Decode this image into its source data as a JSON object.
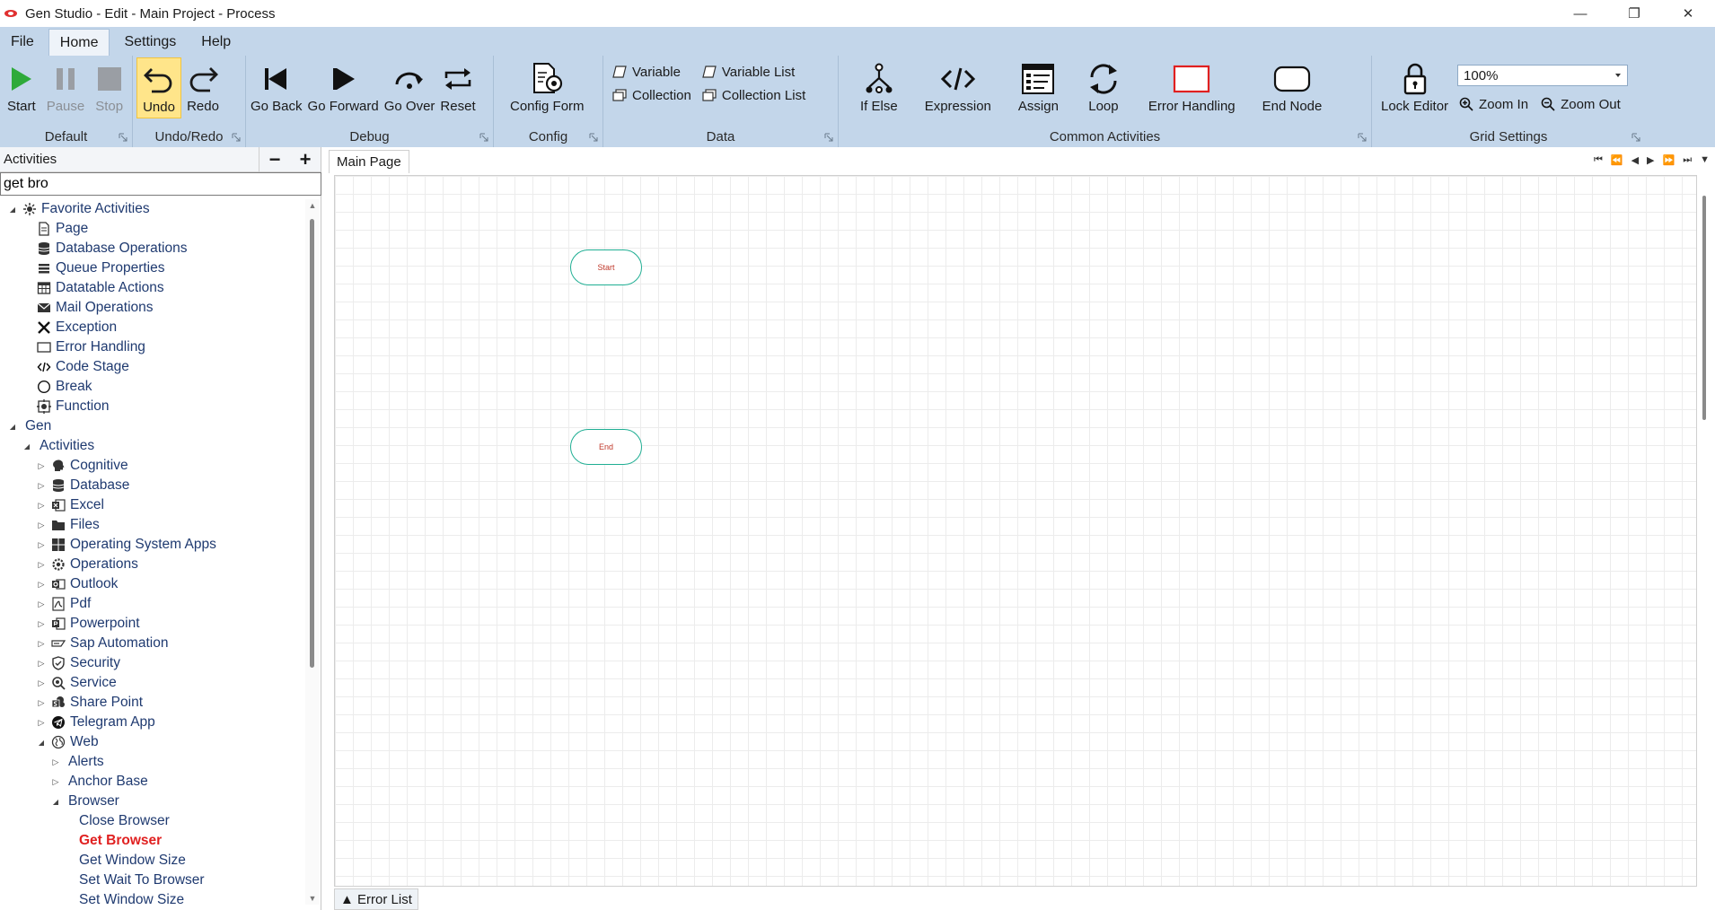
{
  "window": {
    "title": "Gen Studio - Edit - Main Project - Process",
    "controls": {
      "minimize": "—",
      "restore": "❐",
      "close": "✕"
    }
  },
  "menu": {
    "tabs": [
      {
        "label": "File"
      },
      {
        "label": "Home"
      },
      {
        "label": "Settings"
      },
      {
        "label": "Help"
      }
    ]
  },
  "ribbon": {
    "default": {
      "label": "Default",
      "start": "Start",
      "pause": "Pause",
      "stop": "Stop"
    },
    "undo_redo": {
      "label": "Undo/Redo",
      "undo": "Undo",
      "redo": "Redo"
    },
    "debug": {
      "label": "Debug",
      "go_back": "Go Back",
      "go_forward": "Go Forward",
      "go_over": "Go Over",
      "reset": "Reset"
    },
    "config": {
      "label": "Config",
      "config_form": "Config Form"
    },
    "data": {
      "label": "Data",
      "variable": "Variable",
      "collection": "Collection",
      "variable_list": "Variable List",
      "collection_list": "Collection List"
    },
    "common": {
      "label": "Common Activities",
      "if_else": "If Else",
      "expression": "Expression",
      "assign": "Assign",
      "loop": "Loop",
      "error_handling": "Error Handling",
      "end_node": "End Node"
    },
    "grid": {
      "label": "Grid Settings",
      "lock_editor": "Lock Editor",
      "zoom_value": "100%",
      "zoom_in": "Zoom In",
      "zoom_out": "Zoom Out"
    }
  },
  "activities_panel": {
    "title": "Activities",
    "search_value": "get bro",
    "tree": [
      {
        "label": "Favorite Activities",
        "level": 0,
        "expander": "expanded",
        "icon": "favorites-icon"
      },
      {
        "label": "Page",
        "level": 1,
        "expander": "none",
        "icon": "page-icon"
      },
      {
        "label": "Database Operations",
        "level": 1,
        "expander": "none",
        "icon": "database-icon"
      },
      {
        "label": "Queue Properties",
        "level": 1,
        "expander": "none",
        "icon": "queue-icon"
      },
      {
        "label": "Datatable Actions",
        "level": 1,
        "expander": "none",
        "icon": "datatable-icon"
      },
      {
        "label": "Mail Operations",
        "level": 1,
        "expander": "none",
        "icon": "mail-icon"
      },
      {
        "label": "Exception",
        "level": 1,
        "expander": "none",
        "icon": "exception-icon"
      },
      {
        "label": "Error Handling",
        "level": 1,
        "expander": "none",
        "icon": "error-handling-icon"
      },
      {
        "label": "Code Stage",
        "level": 1,
        "expander": "none",
        "icon": "code-icon"
      },
      {
        "label": "Break",
        "level": 1,
        "expander": "none",
        "icon": "break-icon"
      },
      {
        "label": "Function",
        "level": 1,
        "expander": "none",
        "icon": "function-icon"
      },
      {
        "label": "Gen",
        "level": 0,
        "expander": "expanded",
        "icon": ""
      },
      {
        "label": "Activities",
        "level": 1,
        "expander": "expanded",
        "icon": ""
      },
      {
        "label": "Cognitive",
        "level": 2,
        "expander": "collapsed",
        "icon": "cognitive-icon"
      },
      {
        "label": "Database",
        "level": 2,
        "expander": "collapsed",
        "icon": "database-icon"
      },
      {
        "label": "Excel",
        "level": 2,
        "expander": "collapsed",
        "icon": "excel-icon"
      },
      {
        "label": "Files",
        "level": 2,
        "expander": "collapsed",
        "icon": "folder-icon"
      },
      {
        "label": "Operating System Apps",
        "level": 2,
        "expander": "collapsed",
        "icon": "windows-icon"
      },
      {
        "label": "Operations",
        "level": 2,
        "expander": "collapsed",
        "icon": "gear-icon"
      },
      {
        "label": "Outlook",
        "level": 2,
        "expander": "collapsed",
        "icon": "outlook-icon"
      },
      {
        "label": "Pdf",
        "level": 2,
        "expander": "collapsed",
        "icon": "pdf-icon"
      },
      {
        "label": "Powerpoint",
        "level": 2,
        "expander": "collapsed",
        "icon": "powerpoint-icon"
      },
      {
        "label": "Sap Automation",
        "level": 2,
        "expander": "collapsed",
        "icon": "sap-icon"
      },
      {
        "label": "Security",
        "level": 2,
        "expander": "collapsed",
        "icon": "shield-icon"
      },
      {
        "label": "Service",
        "level": 2,
        "expander": "collapsed",
        "icon": "service-icon"
      },
      {
        "label": "Share Point",
        "level": 2,
        "expander": "collapsed",
        "icon": "sharepoint-icon"
      },
      {
        "label": "Telegram App",
        "level": 2,
        "expander": "collapsed",
        "icon": "telegram-icon"
      },
      {
        "label": "Web",
        "level": 2,
        "expander": "expanded",
        "icon": "web-icon"
      },
      {
        "label": "Alerts",
        "level": 3,
        "expander": "collapsed",
        "icon": ""
      },
      {
        "label": "Anchor Base",
        "level": 3,
        "expander": "collapsed",
        "icon": ""
      },
      {
        "label": "Browser",
        "level": 3,
        "expander": "expanded",
        "icon": ""
      },
      {
        "label": "Close Browser",
        "level": 4,
        "expander": "none",
        "icon": ""
      },
      {
        "label": "Get Browser",
        "level": 4,
        "expander": "none",
        "icon": "",
        "selected": true
      },
      {
        "label": "Get Window Size",
        "level": 4,
        "expander": "none",
        "icon": ""
      },
      {
        "label": "Set Wait To Browser",
        "level": 4,
        "expander": "none",
        "icon": ""
      },
      {
        "label": "Set Window Size",
        "level": 4,
        "expander": "none",
        "icon": ""
      }
    ]
  },
  "editor": {
    "tab": "Main Page",
    "nodes": {
      "start": "Start",
      "end": "End"
    },
    "error_list": "▲ Error List"
  },
  "colors": {
    "ribbon_bg": "#c3d6ea",
    "node_border": "#1fae93",
    "selected_text": "#e02020",
    "undo_highlight": "#ffe58a"
  }
}
